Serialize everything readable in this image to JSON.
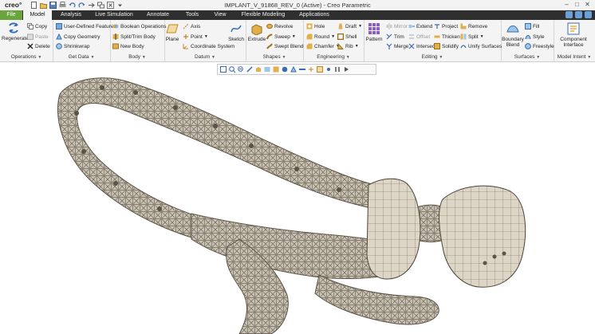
{
  "app": {
    "brand": "creo°",
    "window_title": "IMPLANT_V_91868_REV_0 (Active) - Creo Parametric"
  },
  "tabs": [
    "File",
    "Model",
    "Analysis",
    "Live Simulation",
    "Annotate",
    "Tools",
    "View",
    "Flexible Modeling",
    "Applications"
  ],
  "active_tab": "Model",
  "groups": {
    "operations": {
      "label": "Operations",
      "regenerate": "Regenerate",
      "copy": "Copy",
      "paste": "Paste",
      "delete": "Delete"
    },
    "get_data": {
      "label": "Get Data",
      "udf": "User-Defined Feature",
      "copy_geometry": "Copy Geometry",
      "shrinkwrap": "Shrinkwrap"
    },
    "body": {
      "label": "Body",
      "boolean": "Boolean Operations",
      "split_trim": "Split/Trim Body",
      "new_body": "New Body"
    },
    "datum": {
      "label": "Datum",
      "plane": "Plane",
      "axis": "Axis",
      "point": "Point",
      "csys": "Coordinate System",
      "sketch": "Sketch"
    },
    "shapes": {
      "label": "Shapes",
      "extrude": "Extrude",
      "revolve": "Revolve",
      "sweep": "Sweep",
      "swept_blend": "Swept Blend"
    },
    "engineering": {
      "label": "Engineering",
      "hole": "Hole",
      "round": "Round",
      "chamfer": "Chamfer",
      "draft": "Draft",
      "shell": "Shell",
      "rib": "Rib"
    },
    "editing": {
      "label": "Editing",
      "pattern": "Pattern",
      "mirror": "Mirror",
      "trim": "Trim",
      "merge": "Merge",
      "extend": "Extend",
      "offset": "Offset",
      "intersect": "Intersect",
      "project": "Project",
      "thicken": "Thicken",
      "solidify": "Solidify",
      "remove": "Remove",
      "split": "Split",
      "unify": "Unify Surfaces"
    },
    "surfaces": {
      "label": "Surfaces",
      "boundary_blend": "Boundary Blend",
      "fill": "Fill",
      "style": "Style",
      "freestyle": "Freestyle"
    },
    "model_intent": {
      "label": "Model Intent",
      "component_interface": "Component Interface"
    }
  },
  "colors": {
    "tabbar": "#2f2f2f",
    "file_tab": "#6aa43c",
    "ribbon": "#f4f4f4",
    "model": "#c9c1b2",
    "model_shadow": "#6f675a",
    "nodes": "#8f8677"
  }
}
